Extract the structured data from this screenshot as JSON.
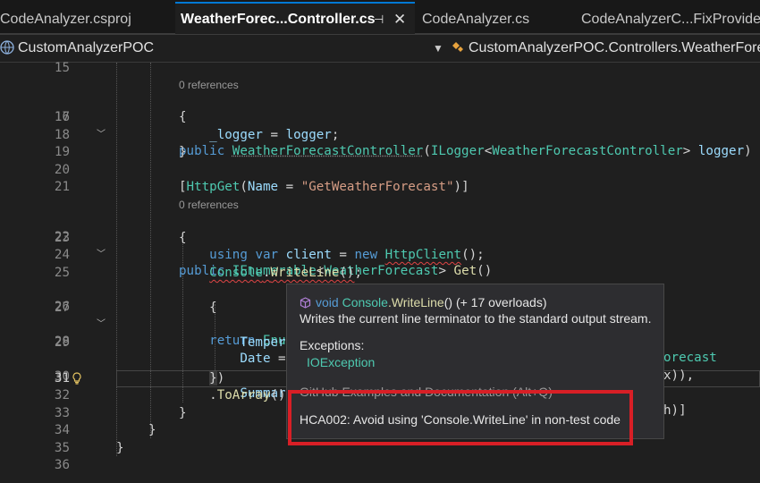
{
  "tabs": [
    {
      "label": "CodeAnalyzer.csproj",
      "active": false
    },
    {
      "label": "WeatherForec...Controller.cs",
      "active": true,
      "pin": "⊣",
      "close": "✕"
    },
    {
      "label": "CodeAnalyzer.cs",
      "active": false
    },
    {
      "label": "CodeAnalyzerC...FixProvider.cs",
      "active": false
    }
  ],
  "navbar": {
    "project": "CustomAnalyzerPOC",
    "member": "CustomAnalyzerPOC.Controllers.WeatherForecas"
  },
  "editor": {
    "current_line": 31,
    "references": [
      "0 references",
      "0 references"
    ],
    "lines": [
      {
        "n": "15",
        "text": ""
      },
      {
        "n": "16",
        "text": "public WeatherForecastController(ILogger<WeatherForecastController> logger)"
      },
      {
        "n": "17",
        "text": "{"
      },
      {
        "n": "18",
        "text": "    _logger = logger;"
      },
      {
        "n": "19",
        "text": "}"
      },
      {
        "n": "20",
        "text": ""
      },
      {
        "n": "21",
        "text": "[HttpGet(Name = \"GetWeatherForecast\")]"
      },
      {
        "n": "22",
        "text": "public IEnumerable<WeatherForecast> Get()"
      },
      {
        "n": "23",
        "text": "{"
      },
      {
        "n": "24",
        "text": "    using var client = new HttpClient();"
      },
      {
        "n": "25",
        "text": "    Console.WriteLine();"
      },
      {
        "n": "26",
        "text": "    return Enu"
      },
      {
        "n": "27",
        "text": "    {"
      },
      {
        "n": "28",
        "text": "        Date ="
      },
      {
        "n": "29",
        "text": "        Temper"
      },
      {
        "n": "30",
        "text": "        Summar"
      },
      {
        "n": "31",
        "text": "    })"
      },
      {
        "n": "32",
        "text": "    .ToArray()"
      },
      {
        "n": "33",
        "text": "}"
      },
      {
        "n": "34",
        "text": "}"
      },
      {
        "n": "35",
        "text": "}"
      },
      {
        "n": "36",
        "text": ""
      }
    ],
    "line26_tail": "orecast",
    "line28_tail": "x)),",
    "line30_tail": "h)]"
  },
  "tooltip": {
    "sig_void": "void",
    "sig_class": "Console",
    "sig_method": ".WriteLine",
    "sig_rest": "() (+ 17 overloads)",
    "description": "Writes the current line terminator to the standard output stream.",
    "exceptions_header": "Exceptions:",
    "exception": "IOException",
    "github_link": "GitHub Examples and Documentation (Alt+Q)",
    "warning": "HCA002: Avoid using 'Console.WriteLine' in non-test code"
  },
  "colors": {
    "keyword": "#569cd6",
    "type": "#4ec9b0",
    "string": "#d69d85",
    "highlight": "#d81f26"
  }
}
